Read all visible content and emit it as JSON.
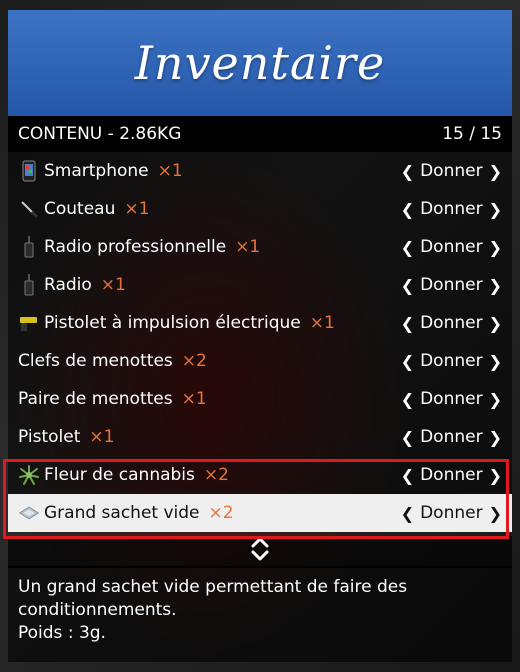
{
  "banner": {
    "title": "Inventaire"
  },
  "header": {
    "label": "CONTENU - 2.86KG",
    "counter": "15 / 15"
  },
  "items": [
    {
      "name": "Smartphone",
      "qty": "×1",
      "icon": "smartphone-icon"
    },
    {
      "name": "Couteau",
      "qty": "×1",
      "icon": "knife-icon"
    },
    {
      "name": "Radio professionnelle",
      "qty": "×1",
      "icon": "radio-icon"
    },
    {
      "name": "Radio",
      "qty": "×1",
      "icon": "radio-icon"
    },
    {
      "name": "Pistolet à impulsion électrique",
      "qty": "×1",
      "icon": "taser-icon"
    },
    {
      "name": "Clefs de menottes",
      "qty": "×2",
      "icon": ""
    },
    {
      "name": "Paire de menottes",
      "qty": "×1",
      "icon": ""
    },
    {
      "name": "Pistolet",
      "qty": "×1",
      "icon": ""
    },
    {
      "name": "Fleur de cannabis",
      "qty": "×2",
      "icon": "cannabis-icon"
    },
    {
      "name": "Grand sachet vide",
      "qty": "×2",
      "icon": "bag-icon",
      "selected": true
    }
  ],
  "action_label": "Donner",
  "description": {
    "text": "Un grand sachet vide permettant de faire des conditionnements.",
    "weight": "Poids : 3g."
  },
  "colors": {
    "banner": "#2f64b8",
    "quantity": "#e8733a",
    "highlight": "#e0191f"
  }
}
